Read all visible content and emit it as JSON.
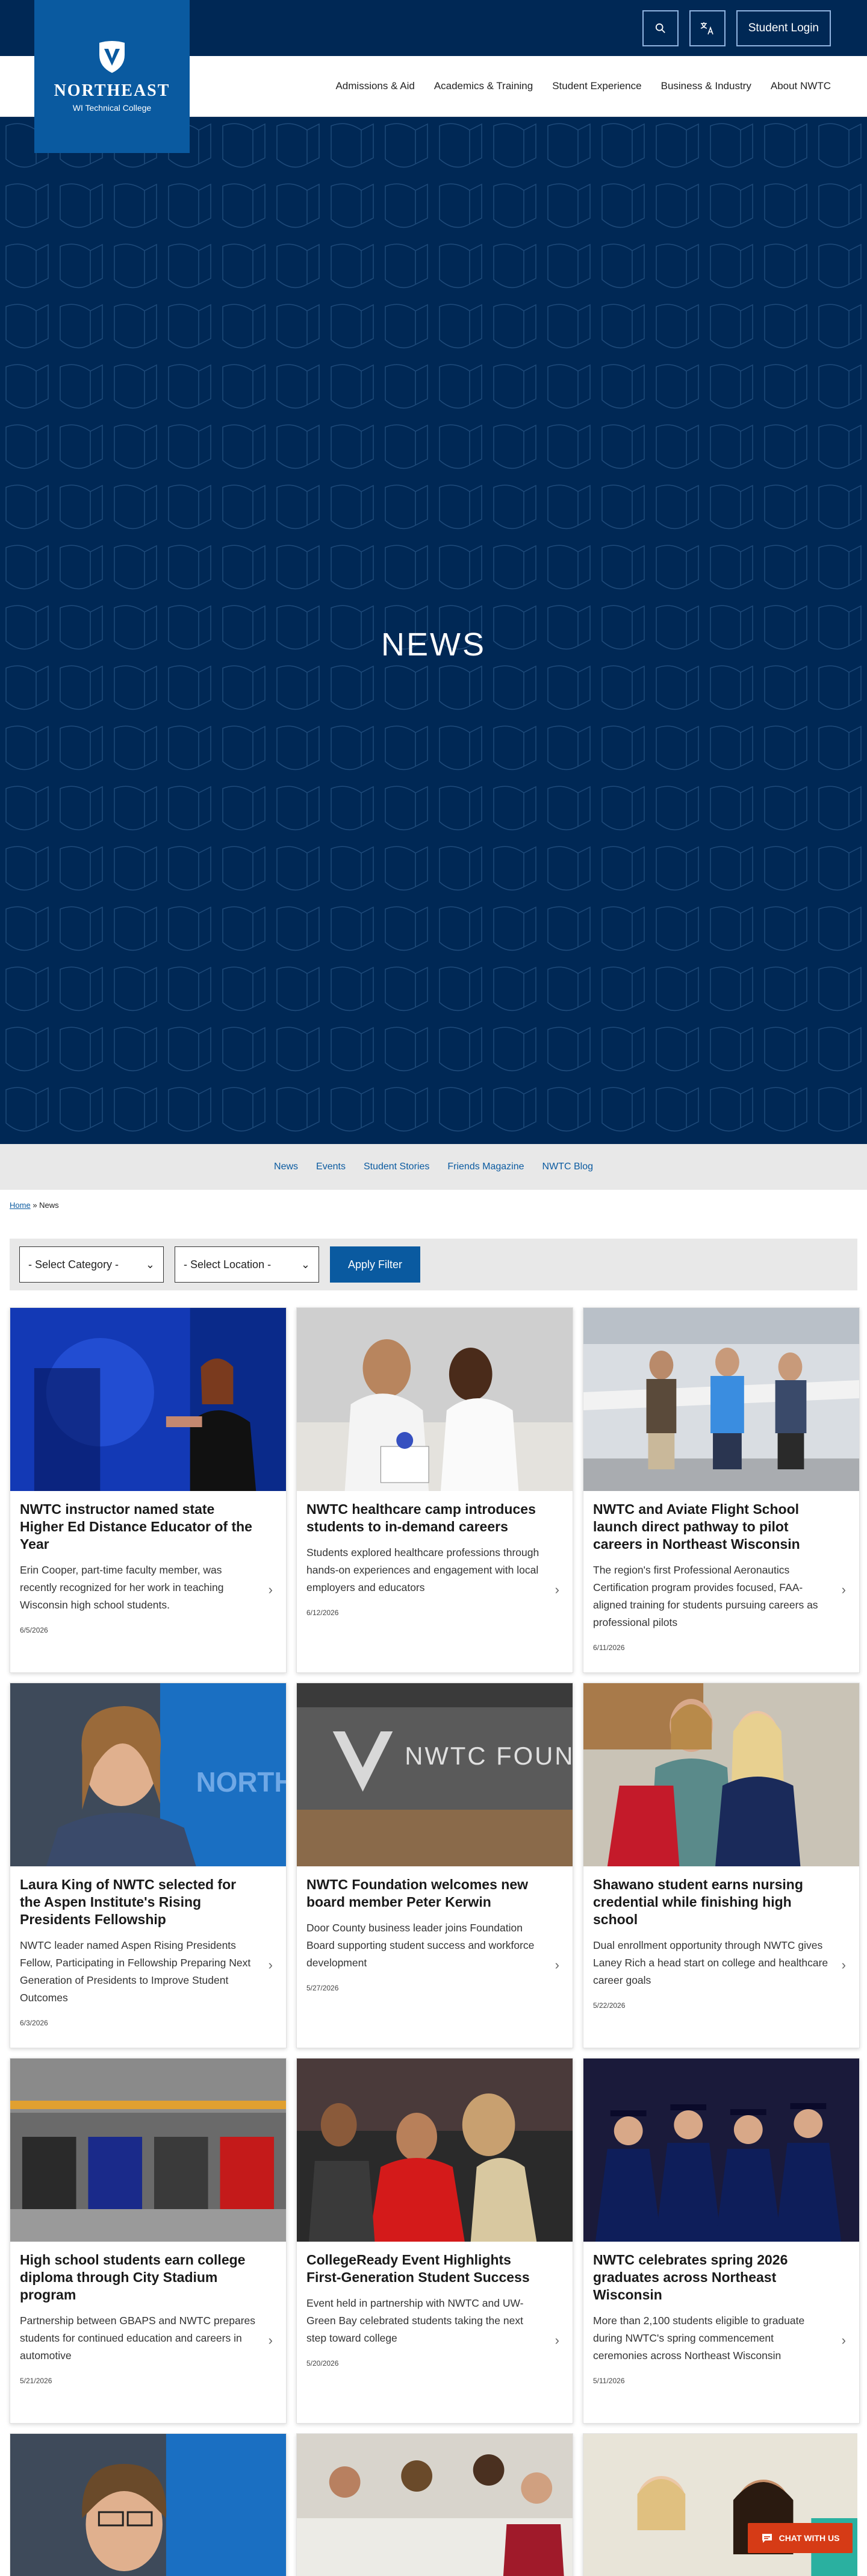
{
  "header": {
    "logo": {
      "name": "NORTHEAST",
      "subtitle": "WI Technical College"
    },
    "utility": {
      "search_icon": "search-icon",
      "language_icon": "translate-icon",
      "login_label": "Student Login"
    },
    "nav": [
      "Admissions & Aid",
      "Academics & Training",
      "Student Experience",
      "Business & Industry",
      "About NWTC"
    ]
  },
  "hero": {
    "title": "NEWS"
  },
  "subnav": [
    "News",
    "Events",
    "Student Stories",
    "Friends Magazine",
    "NWTC Blog"
  ],
  "breadcrumb": {
    "home": "Home",
    "separator": "»",
    "current": "News"
  },
  "filters": {
    "category": "- Select Category -",
    "location": "- Select Location -",
    "apply": "Apply Filter"
  },
  "cards": [
    {
      "title": "NWTC instructor named state Higher Ed Distance Educator of the Year",
      "desc": "Erin Cooper, part-time faculty member, was recently recognized for her work in teaching Wisconsin high school students.",
      "date": "6/5/2026"
    },
    {
      "title": "NWTC healthcare camp introduces students to in-demand careers",
      "desc": "Students explored healthcare professions through hands-on experiences and engagement with local employers and educators",
      "date": "6/12/2026"
    },
    {
      "title": "NWTC and Aviate Flight School launch direct pathway to pilot careers in Northeast Wisconsin",
      "desc": "The region's first Professional Aeronautics Certification program provides focused, FAA-aligned training for students pursuing careers as professional pilots",
      "date": "6/11/2026"
    },
    {
      "title": "Laura King of NWTC selected for the Aspen Institute's Rising Presidents Fellowship",
      "desc": "NWTC leader named Aspen Rising Presidents Fellow, Participating in Fellowship Preparing Next Generation of Presidents to Improve Student Outcomes",
      "date": "6/3/2026"
    },
    {
      "title": "NWTC Foundation welcomes new board member Peter Kerwin",
      "desc": "Door County business leader joins Foundation Board supporting student success and workforce development",
      "date": "5/27/2026"
    },
    {
      "title": "Shawano student earns nursing credential while finishing high school",
      "desc": "Dual enrollment opportunity through NWTC gives Laney Rich a head start on college and healthcare career goals",
      "date": "5/22/2026"
    },
    {
      "title": "High school students earn college diploma through City Stadium program",
      "desc": "Partnership between GBAPS and NWTC prepares students for continued education and careers in automotive",
      "date": "5/21/2026"
    },
    {
      "title": "CollegeReady Event Highlights First-Generation Student Success",
      "desc": "Event held in partnership with NWTC and UW-Green Bay celebrated students taking the next step toward college",
      "date": "5/20/2026"
    },
    {
      "title": "NWTC celebrates spring 2026 graduates across Northeast Wisconsin",
      "desc": "More than 2,100 students eligible to graduate during NWTC's spring commencement ceremonies across Northeast Wisconsin",
      "date": "5/11/2026"
    }
  ],
  "image_text": {
    "foundation_sign": "NWTC FOUNDATION",
    "backdrop": "NORTHEA"
  },
  "chat": {
    "label": "CHAT WITH US",
    "icon": "chat-icon"
  },
  "colors": {
    "navy": "#002855",
    "blue": "#0a5aa0",
    "chat": "#d63b16"
  }
}
